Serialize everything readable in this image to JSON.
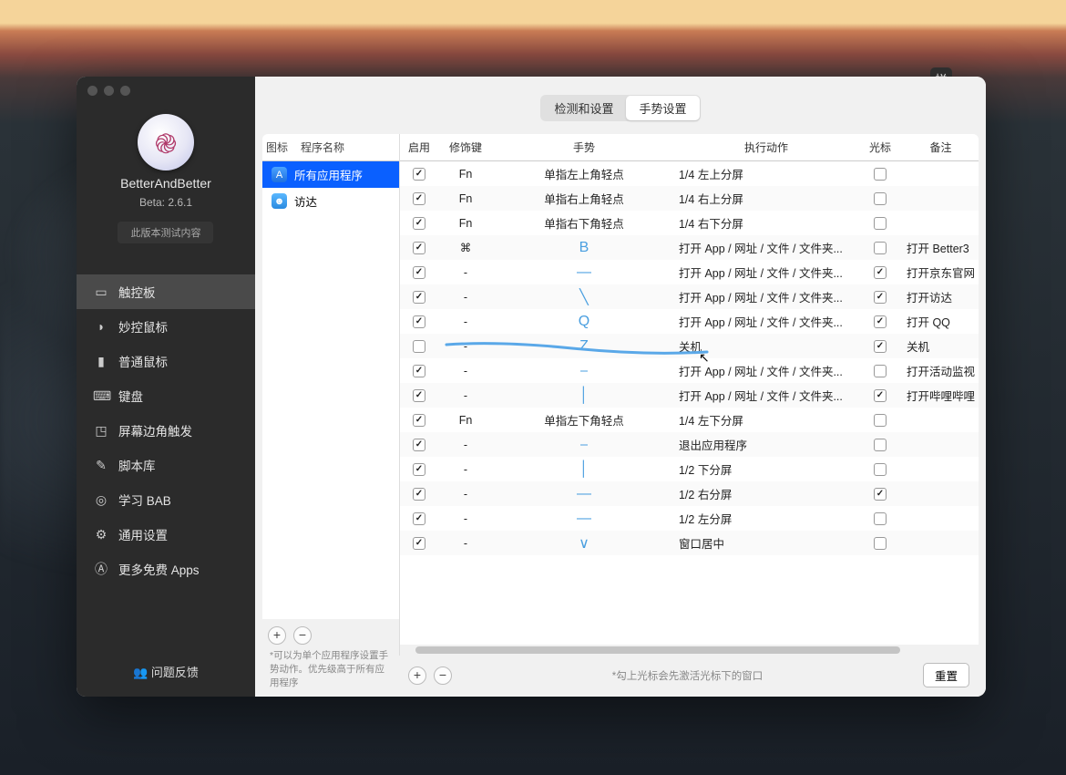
{
  "app": {
    "name": "BetterAndBetter",
    "version_label": "Beta:  2.6.1",
    "beta_button": "此版本测试内容",
    "feedback": "问题反馈"
  },
  "sidebar": {
    "items": [
      {
        "icon": "▭",
        "label": "触控板"
      },
      {
        "icon": "◗",
        "label": "妙控鼠标"
      },
      {
        "icon": "▮",
        "label": "普通鼠标"
      },
      {
        "icon": "⌨",
        "label": "键盘"
      },
      {
        "icon": "◳",
        "label": "屏幕边角触发"
      },
      {
        "icon": "✎",
        "label": "脚本库"
      },
      {
        "icon": "◎",
        "label": "学习 BAB"
      },
      {
        "icon": "⚙",
        "label": "通用设置"
      },
      {
        "icon": "Ⓐ",
        "label": "更多免费 Apps"
      }
    ],
    "active_index": 0
  },
  "tabs": {
    "items": [
      "检测和设置",
      "手势设置"
    ],
    "active_index": 1
  },
  "apps": {
    "columns": [
      "图标",
      "程序名称"
    ],
    "rows": [
      {
        "icon": "A",
        "label": "所有应用程序",
        "selected": true,
        "icon_cls": "aic-blue"
      },
      {
        "icon": "☻",
        "label": "访达",
        "selected": false,
        "icon_cls": "aic-finder"
      }
    ],
    "add": "+",
    "remove": "−",
    "hint": "*可以为单个应用程序设置手势动作。优先级高于所有应用程序"
  },
  "gest": {
    "columns": {
      "enable": "启用",
      "modifier": "修饰键",
      "gesture": "手势",
      "action": "执行动作",
      "cursor": "光标",
      "note": "备注"
    },
    "rows": [
      {
        "en": true,
        "mod": "Fn",
        "gest": "单指左上角轻点",
        "act": "1/4 左上分屏",
        "cur": false,
        "note": ""
      },
      {
        "en": true,
        "mod": "Fn",
        "gest": "单指右上角轻点",
        "act": "1/4 右上分屏",
        "cur": false,
        "note": ""
      },
      {
        "en": true,
        "mod": "Fn",
        "gest": "单指右下角轻点",
        "act": "1/4 右下分屏",
        "cur": false,
        "note": ""
      },
      {
        "en": true,
        "mod": "⌘",
        "gest": "B",
        "glyph": true,
        "act": "打开 App / 网址 / 文件 / 文件夹...",
        "cur": false,
        "note": "打开 Better3"
      },
      {
        "en": true,
        "mod": "-",
        "gest": "—",
        "glyph": true,
        "act": "打开 App / 网址 / 文件 / 文件夹...",
        "cur": true,
        "note": "打开京东官网"
      },
      {
        "en": true,
        "mod": "-",
        "gest": "╲",
        "glyph": true,
        "act": "打开 App / 网址 / 文件 / 文件夹...",
        "cur": true,
        "note": "打开访达"
      },
      {
        "en": true,
        "mod": "-",
        "gest": "Q",
        "glyph": true,
        "act": "打开 App / 网址 / 文件 / 文件夹...",
        "cur": true,
        "note": "打开 QQ"
      },
      {
        "en": false,
        "mod": "-",
        "gest": "Z",
        "glyph": true,
        "act": "关机",
        "cur": true,
        "note": "关机"
      },
      {
        "en": true,
        "mod": "-",
        "gest": "⎯",
        "glyph": true,
        "act": "打开 App / 网址 / 文件 / 文件夹...",
        "cur": false,
        "note": "打开活动监视"
      },
      {
        "en": true,
        "mod": "-",
        "gest": "│",
        "glyph": true,
        "act": "打开 App / 网址 / 文件 / 文件夹...",
        "cur": true,
        "note": "打开哔哩哔哩"
      },
      {
        "en": true,
        "mod": "Fn",
        "gest": "单指左下角轻点",
        "act": "1/4 左下分屏",
        "cur": false,
        "note": ""
      },
      {
        "en": true,
        "mod": "-",
        "gest": "⎯",
        "glyph": true,
        "act": "退出应用程序",
        "cur": false,
        "note": ""
      },
      {
        "en": true,
        "mod": "-",
        "gest": "│",
        "glyph": true,
        "act": "1/2 下分屏",
        "cur": false,
        "note": ""
      },
      {
        "en": true,
        "mod": "-",
        "gest": "—",
        "glyph": true,
        "act": "1/2 右分屏",
        "cur": true,
        "note": ""
      },
      {
        "en": true,
        "mod": "-",
        "gest": "—",
        "glyph": true,
        "act": "1/2 左分屏",
        "cur": false,
        "note": ""
      },
      {
        "en": true,
        "mod": "-",
        "gest": "∨",
        "glyph": true,
        "act": "窗口居中",
        "cur": false,
        "note": ""
      }
    ],
    "footer_hint": "*勾上光标会先激活光标下的窗口",
    "reset": "重置",
    "add": "+",
    "remove": "−"
  },
  "ime_badge": "拼"
}
